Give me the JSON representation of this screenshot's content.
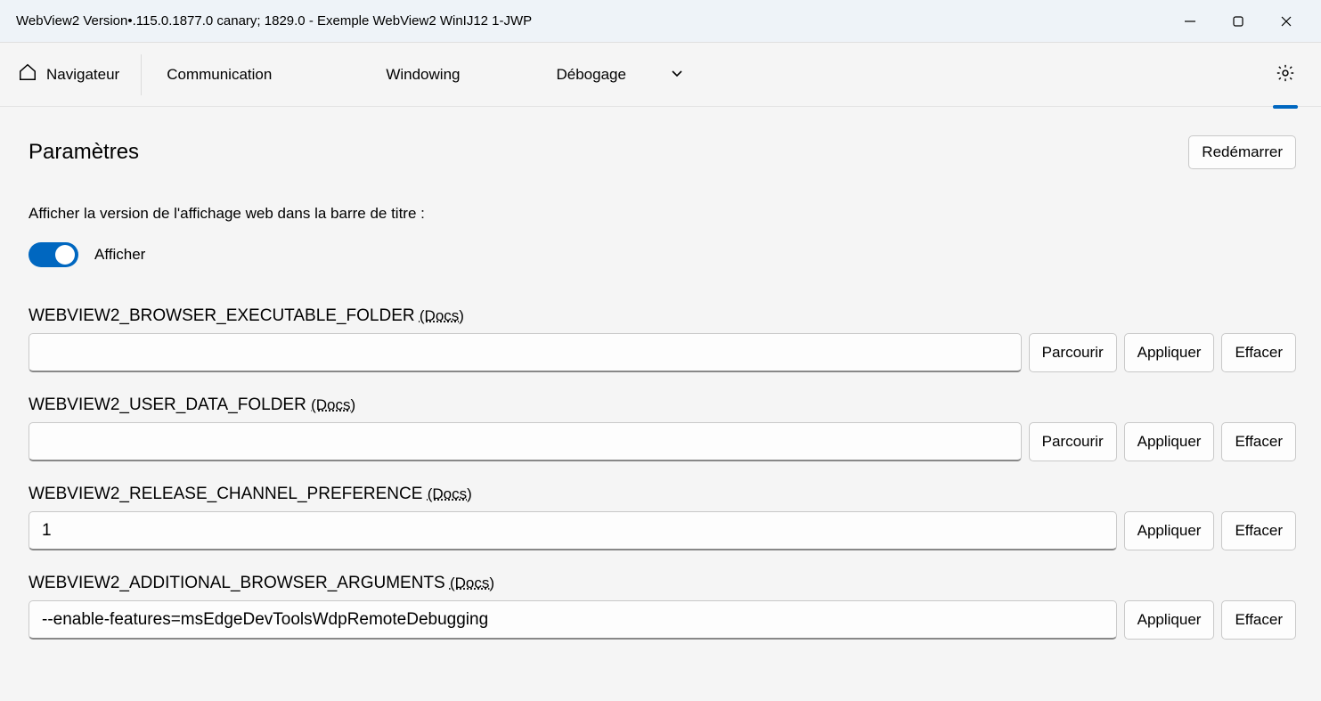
{
  "window": {
    "title": "WebView2 Version•.115.0.1877.0 canary; 1829.0 - Exemple WebView2 WinIJ12 1-JWP"
  },
  "nav": {
    "home": "Navigateur",
    "comm": "Communication",
    "windowing": "Windowing",
    "debug": "Débogage"
  },
  "page": {
    "heading": "Paramètres",
    "restart": "Redémarrer",
    "show_version_label": "Afficher la version de l'affichage web dans la barre de titre :",
    "toggle_label": "Afficher"
  },
  "buttons": {
    "browse": "Parcourir",
    "apply": "Appliquer",
    "clear": "Effacer"
  },
  "fields": [
    {
      "label": "WEBVIEW2_BROWSER_EXECUTABLE_FOLDER",
      "docs": "(Docs)",
      "value": "",
      "has_browse": true
    },
    {
      "label": "WEBVIEW2_USER_DATA_FOLDER",
      "docs": "(Docs)",
      "value": "",
      "has_browse": true
    },
    {
      "label": "WEBVIEW2_RELEASE_CHANNEL_PREFERENCE",
      "docs": "(Docs)",
      "value": "1",
      "has_browse": false
    },
    {
      "label": "WEBVIEW2_ADDITIONAL_BROWSER_ARGUMENTS",
      "docs": "(Docs)",
      "value": "--enable-features=msEdgeDevToolsWdpRemoteDebugging",
      "has_browse": false
    }
  ]
}
